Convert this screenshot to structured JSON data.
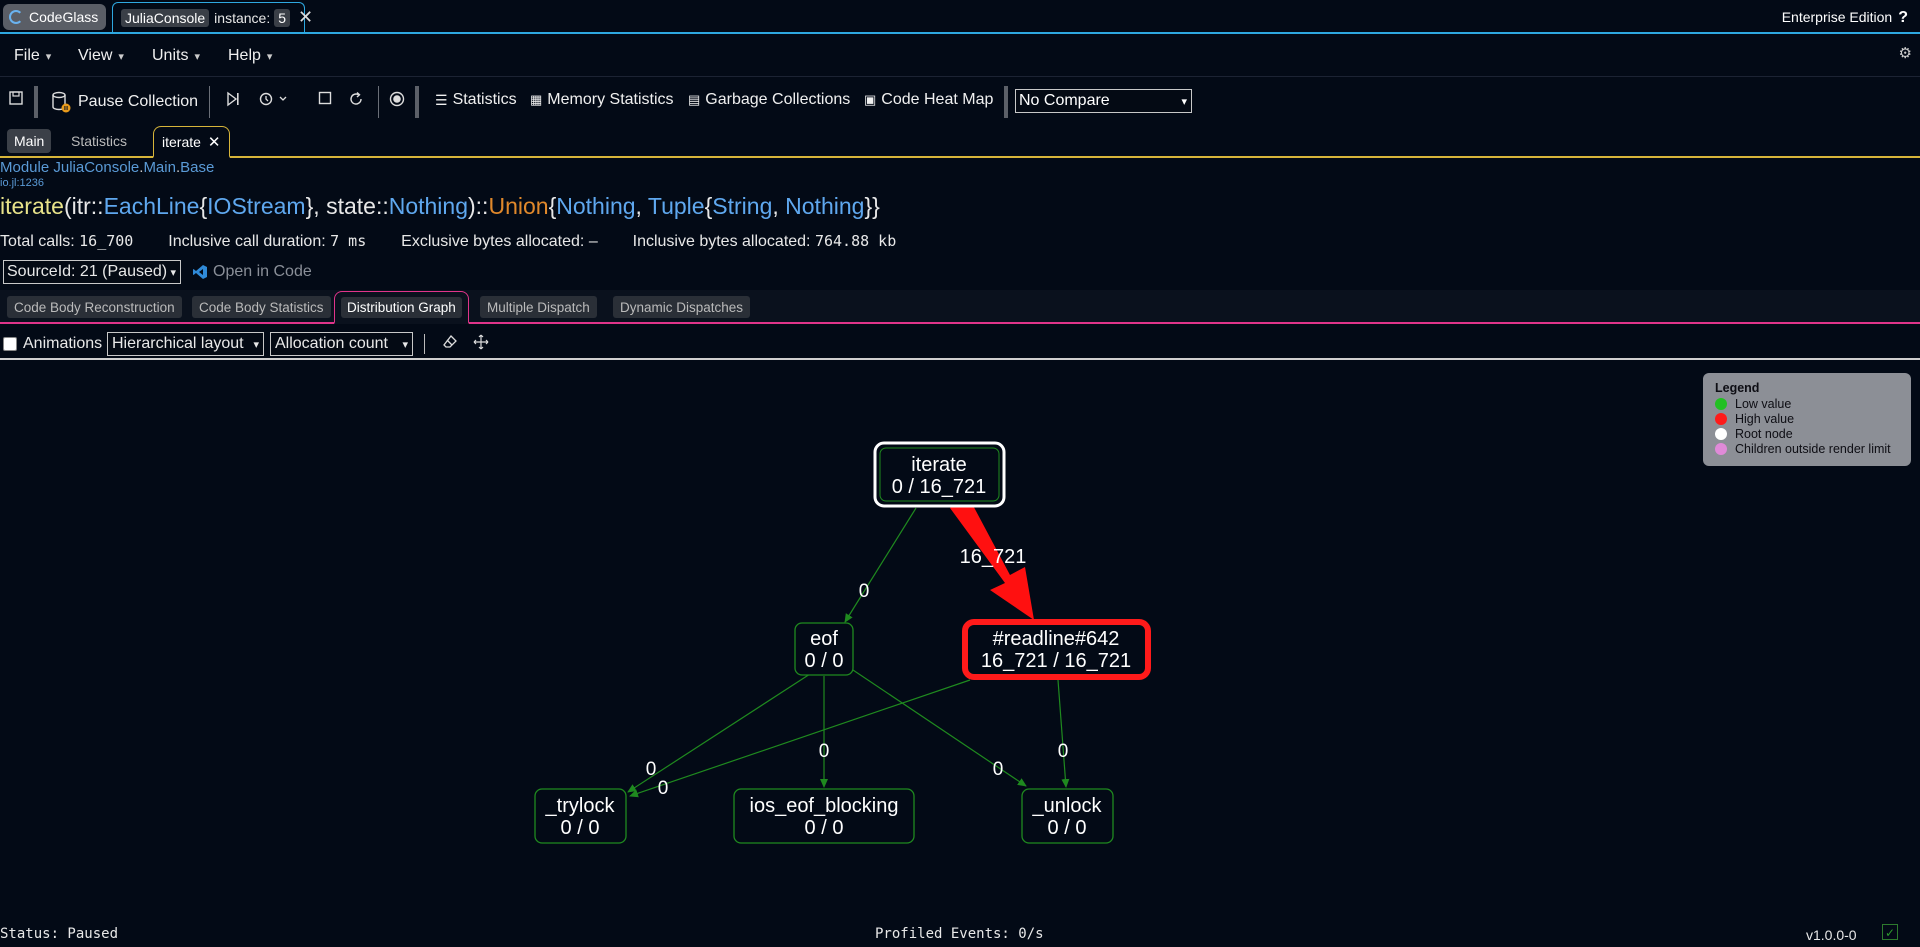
{
  "titlebar": {
    "app_tab": "CodeGlass",
    "console_tab": "JuliaConsole",
    "instance_label": "instance:",
    "instance_number": "5",
    "edition": "Enterprise Edition",
    "help": "?"
  },
  "menu": [
    "File",
    "View",
    "Units",
    "Help"
  ],
  "toolbar": {
    "pause_collection": "Pause Collection",
    "statistics": "Statistics",
    "memory_statistics": "Memory Statistics",
    "garbage_collections": "Garbage Collections",
    "code_heat_map": "Code Heat Map",
    "compare_selected": "No Compare"
  },
  "doc_tabs": [
    "Main",
    "Statistics",
    "iterate"
  ],
  "header": {
    "module_word": "Module",
    "module_parts": [
      "JuliaConsole",
      "Main",
      "Base"
    ],
    "file": "io.jl:1236",
    "signature": {
      "fn": "iterate",
      "arg1": "itr",
      "type1": "EachLine",
      "type1_param": "IOStream",
      "arg2": "state",
      "type2": "Nothing",
      "ret": "Union",
      "ret_a": "Nothing",
      "ret_b": "Tuple",
      "ret_b1": "String",
      "ret_b2": "Nothing"
    },
    "metrics": {
      "total_calls_label": "Total calls:",
      "total_calls": "16_700",
      "inclusive_duration_label": "Inclusive call duration:",
      "inclusive_duration": "7 ms",
      "exclusive_bytes_label": "Exclusive bytes allocated:",
      "exclusive_bytes": "–",
      "inclusive_bytes_label": "Inclusive bytes allocated:",
      "inclusive_bytes": "764.88 kb"
    },
    "source_selected": "SourceId: 21 (Paused)",
    "open_in_code": "Open in Code"
  },
  "sub_tabs": [
    "Code Body Reconstruction",
    "Code Body Statistics",
    "Distribution Graph",
    "Multiple Dispatch",
    "Dynamic Dispatches"
  ],
  "graph_toolbar": {
    "animations_label": "Animations",
    "animations_checked": false,
    "layout_selected": "Hierarchical layout",
    "metric_selected": "Allocation count"
  },
  "legend": {
    "title": "Legend",
    "items": [
      {
        "label": "Low value",
        "color": "#22c022"
      },
      {
        "label": "High value",
        "color": "#ff1a1a"
      },
      {
        "label": "Root node",
        "color": "#ffffff"
      },
      {
        "label": "Children outside render limit",
        "color": "#e08ad8"
      }
    ]
  },
  "graph": {
    "nodes": [
      {
        "id": "iterate",
        "name": "iterate",
        "value": "0 / 16_721",
        "kind": "root"
      },
      {
        "id": "eof",
        "name": "eof",
        "value": "0 / 0",
        "kind": "low"
      },
      {
        "id": "readline",
        "name": "#readline#642",
        "value": "16_721 / 16_721",
        "kind": "high"
      },
      {
        "id": "trylock",
        "name": "_trylock",
        "value": "0 / 0",
        "kind": "low"
      },
      {
        "id": "ios_eof",
        "name": "ios_eof_blocking",
        "value": "0 / 0",
        "kind": "low"
      },
      {
        "id": "unlock",
        "name": "_unlock",
        "value": "0 / 0",
        "kind": "low"
      }
    ],
    "edges": [
      {
        "from": "iterate",
        "to": "eof",
        "label": "0"
      },
      {
        "from": "iterate",
        "to": "readline",
        "label": "16_721"
      },
      {
        "from": "eof",
        "to": "trylock",
        "label": "0"
      },
      {
        "from": "eof",
        "to": "ios_eof",
        "label": "0"
      },
      {
        "from": "eof",
        "to": "unlock",
        "label": "0"
      },
      {
        "from": "readline",
        "to": "trylock",
        "label": "0"
      },
      {
        "from": "readline",
        "to": "unlock",
        "label": "0"
      }
    ],
    "colors": {
      "low": "#1f8a1f",
      "high": "#ff1a1a",
      "root": "#ffffff"
    }
  },
  "status": {
    "left": "Status: Paused",
    "middle": "Profiled Events: 0/s",
    "version": "v1.0.0-0"
  }
}
